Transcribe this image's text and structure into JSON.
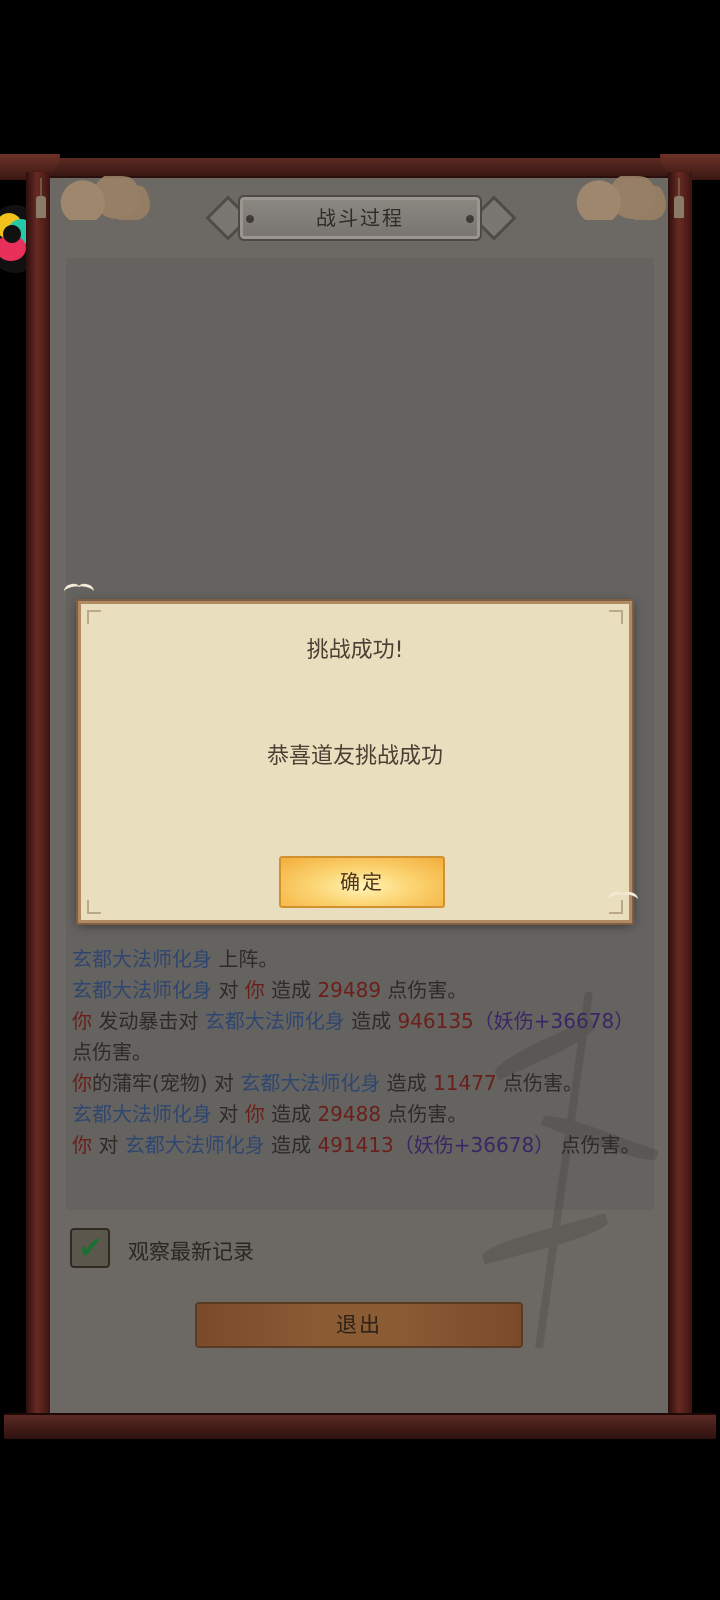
{
  "panel": {
    "title": "战斗过程"
  },
  "battle_log": [
    [
      {
        "text": "玄都大法师化身",
        "color": "blue"
      },
      {
        "text": " 上阵。",
        "color": "dark"
      }
    ],
    [
      {
        "text": "玄都大法师化身",
        "color": "blue"
      },
      {
        "text": " 对 ",
        "color": "dark"
      },
      {
        "text": "你",
        "color": "red"
      },
      {
        "text": " 造成 ",
        "color": "dark"
      },
      {
        "text": "29489",
        "color": "red"
      },
      {
        "text": " 点伤害。",
        "color": "dark"
      }
    ],
    [
      {
        "text": "你",
        "color": "red"
      },
      {
        "text": " 发动暴击对 ",
        "color": "dark"
      },
      {
        "text": "玄都大法师化身",
        "color": "blue"
      },
      {
        "text": " 造成 ",
        "color": "dark"
      },
      {
        "text": "946135",
        "color": "red"
      },
      {
        "text": "（妖伤+36678）",
        "color": "purple"
      },
      {
        "text": "点伤害。",
        "color": "dark"
      }
    ],
    [
      {
        "text": "你",
        "color": "red"
      },
      {
        "text": "的蒲牢(宠物) 对 ",
        "color": "dark"
      },
      {
        "text": "玄都大法师化身",
        "color": "blue"
      },
      {
        "text": " 造成 ",
        "color": "dark"
      },
      {
        "text": "11477",
        "color": "red"
      },
      {
        "text": " 点伤害。",
        "color": "dark"
      }
    ],
    [
      {
        "text": "玄都大法师化身",
        "color": "blue"
      },
      {
        "text": " 对 ",
        "color": "dark"
      },
      {
        "text": "你",
        "color": "red"
      },
      {
        "text": " 造成 ",
        "color": "dark"
      },
      {
        "text": "29488",
        "color": "red"
      },
      {
        "text": " 点伤害。",
        "color": "dark"
      }
    ],
    [
      {
        "text": "你",
        "color": "red"
      },
      {
        "text": " 对 ",
        "color": "dark"
      },
      {
        "text": "玄都大法师化身",
        "color": "blue"
      },
      {
        "text": " 造成 ",
        "color": "dark"
      },
      {
        "text": "491413",
        "color": "red"
      },
      {
        "text": "（妖伤+36678）",
        "color": "purple"
      },
      {
        "text": " 点伤害。",
        "color": "dark"
      }
    ]
  ],
  "options": {
    "watch_latest_label": "观察最新记录",
    "watch_latest_checked": true
  },
  "buttons": {
    "exit_label": "退出"
  },
  "dialog": {
    "title": "挑战成功!",
    "message": "恭喜道友挑战成功",
    "confirm_label": "确定"
  },
  "colors": {
    "name_blue": "#2f4670",
    "damage_red": "#6a1f1a",
    "bonus_purple": "#3a2565",
    "dialog_bg": "#e9dfbf",
    "confirm_gold": "#f3ad3a"
  }
}
